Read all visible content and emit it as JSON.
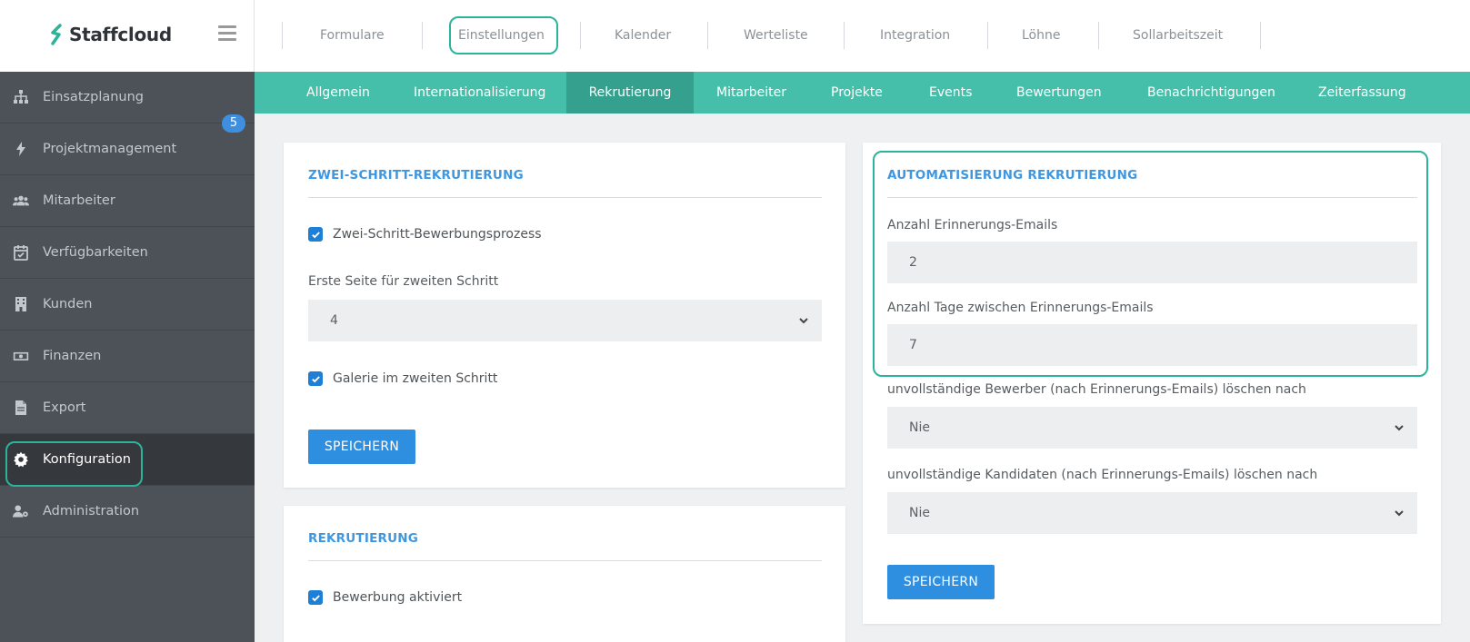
{
  "brand": {
    "name": "Staffcloud"
  },
  "sidebar": {
    "items": [
      {
        "label": "Einsatzplanung",
        "icon": "sitemap-icon"
      },
      {
        "label": "Projektmanagement",
        "icon": "bolt-icon"
      },
      {
        "label": "Mitarbeiter",
        "icon": "users-icon",
        "badge": "5"
      },
      {
        "label": "Verfügbarkeiten",
        "icon": "calendar-check-icon"
      },
      {
        "label": "Kunden",
        "icon": "building-icon"
      },
      {
        "label": "Finanzen",
        "icon": "money-icon"
      },
      {
        "label": "Export",
        "icon": "file-icon"
      },
      {
        "label": "Konfiguration",
        "icon": "gear-icon",
        "active": true
      },
      {
        "label": "Administration",
        "icon": "user-cog-icon"
      }
    ]
  },
  "topnav": {
    "tabs": [
      "Formulare",
      "Einstellungen",
      "Kalender",
      "Werteliste",
      "Integration",
      "Löhne",
      "Sollarbeitszeit"
    ],
    "active": "Einstellungen"
  },
  "subnav": {
    "tabs": [
      "Allgemein",
      "Internationalisierung",
      "Rekrutierung",
      "Mitarbeiter",
      "Projekte",
      "Events",
      "Bewertungen",
      "Benachrichtigungen",
      "Zeiterfassung"
    ],
    "active": "Rekrutierung"
  },
  "two_step": {
    "title": "ZWEI-SCHRITT-REKRUTIERUNG",
    "checkbox1": "Zwei-Schritt-Bewerbungsprozess",
    "first_page_label": "Erste Seite für zweiten Schritt",
    "first_page_value": "4",
    "checkbox2": "Galerie im zweiten Schritt",
    "save": "SPEICHERN"
  },
  "recruiting": {
    "title": "REKRUTIERUNG",
    "checkbox1": "Bewerbung aktiviert"
  },
  "automation": {
    "title": "AUTOMATISIERUNG REKRUTIERUNG",
    "reminder_count_label": "Anzahl Erinnerungs-Emails",
    "reminder_count_value": "2",
    "reminder_days_label": "Anzahl Tage zwischen Erinnerungs-Emails",
    "reminder_days_value": "7",
    "delete_applicants_label": "unvollständige Bewerber (nach Erinnerungs-Emails) löschen nach",
    "delete_applicants_value": "Nie",
    "delete_candidates_label": "unvollständige Kandidaten (nach Erinnerungs-Emails) löschen nach",
    "delete_candidates_value": "Nie",
    "save": "SPEICHERN"
  },
  "colors": {
    "accent_teal": "#45bfa9",
    "highlight": "#2bb39b",
    "primary_blue": "#2e8ee0",
    "sidebar_bg": "#4c5258"
  }
}
